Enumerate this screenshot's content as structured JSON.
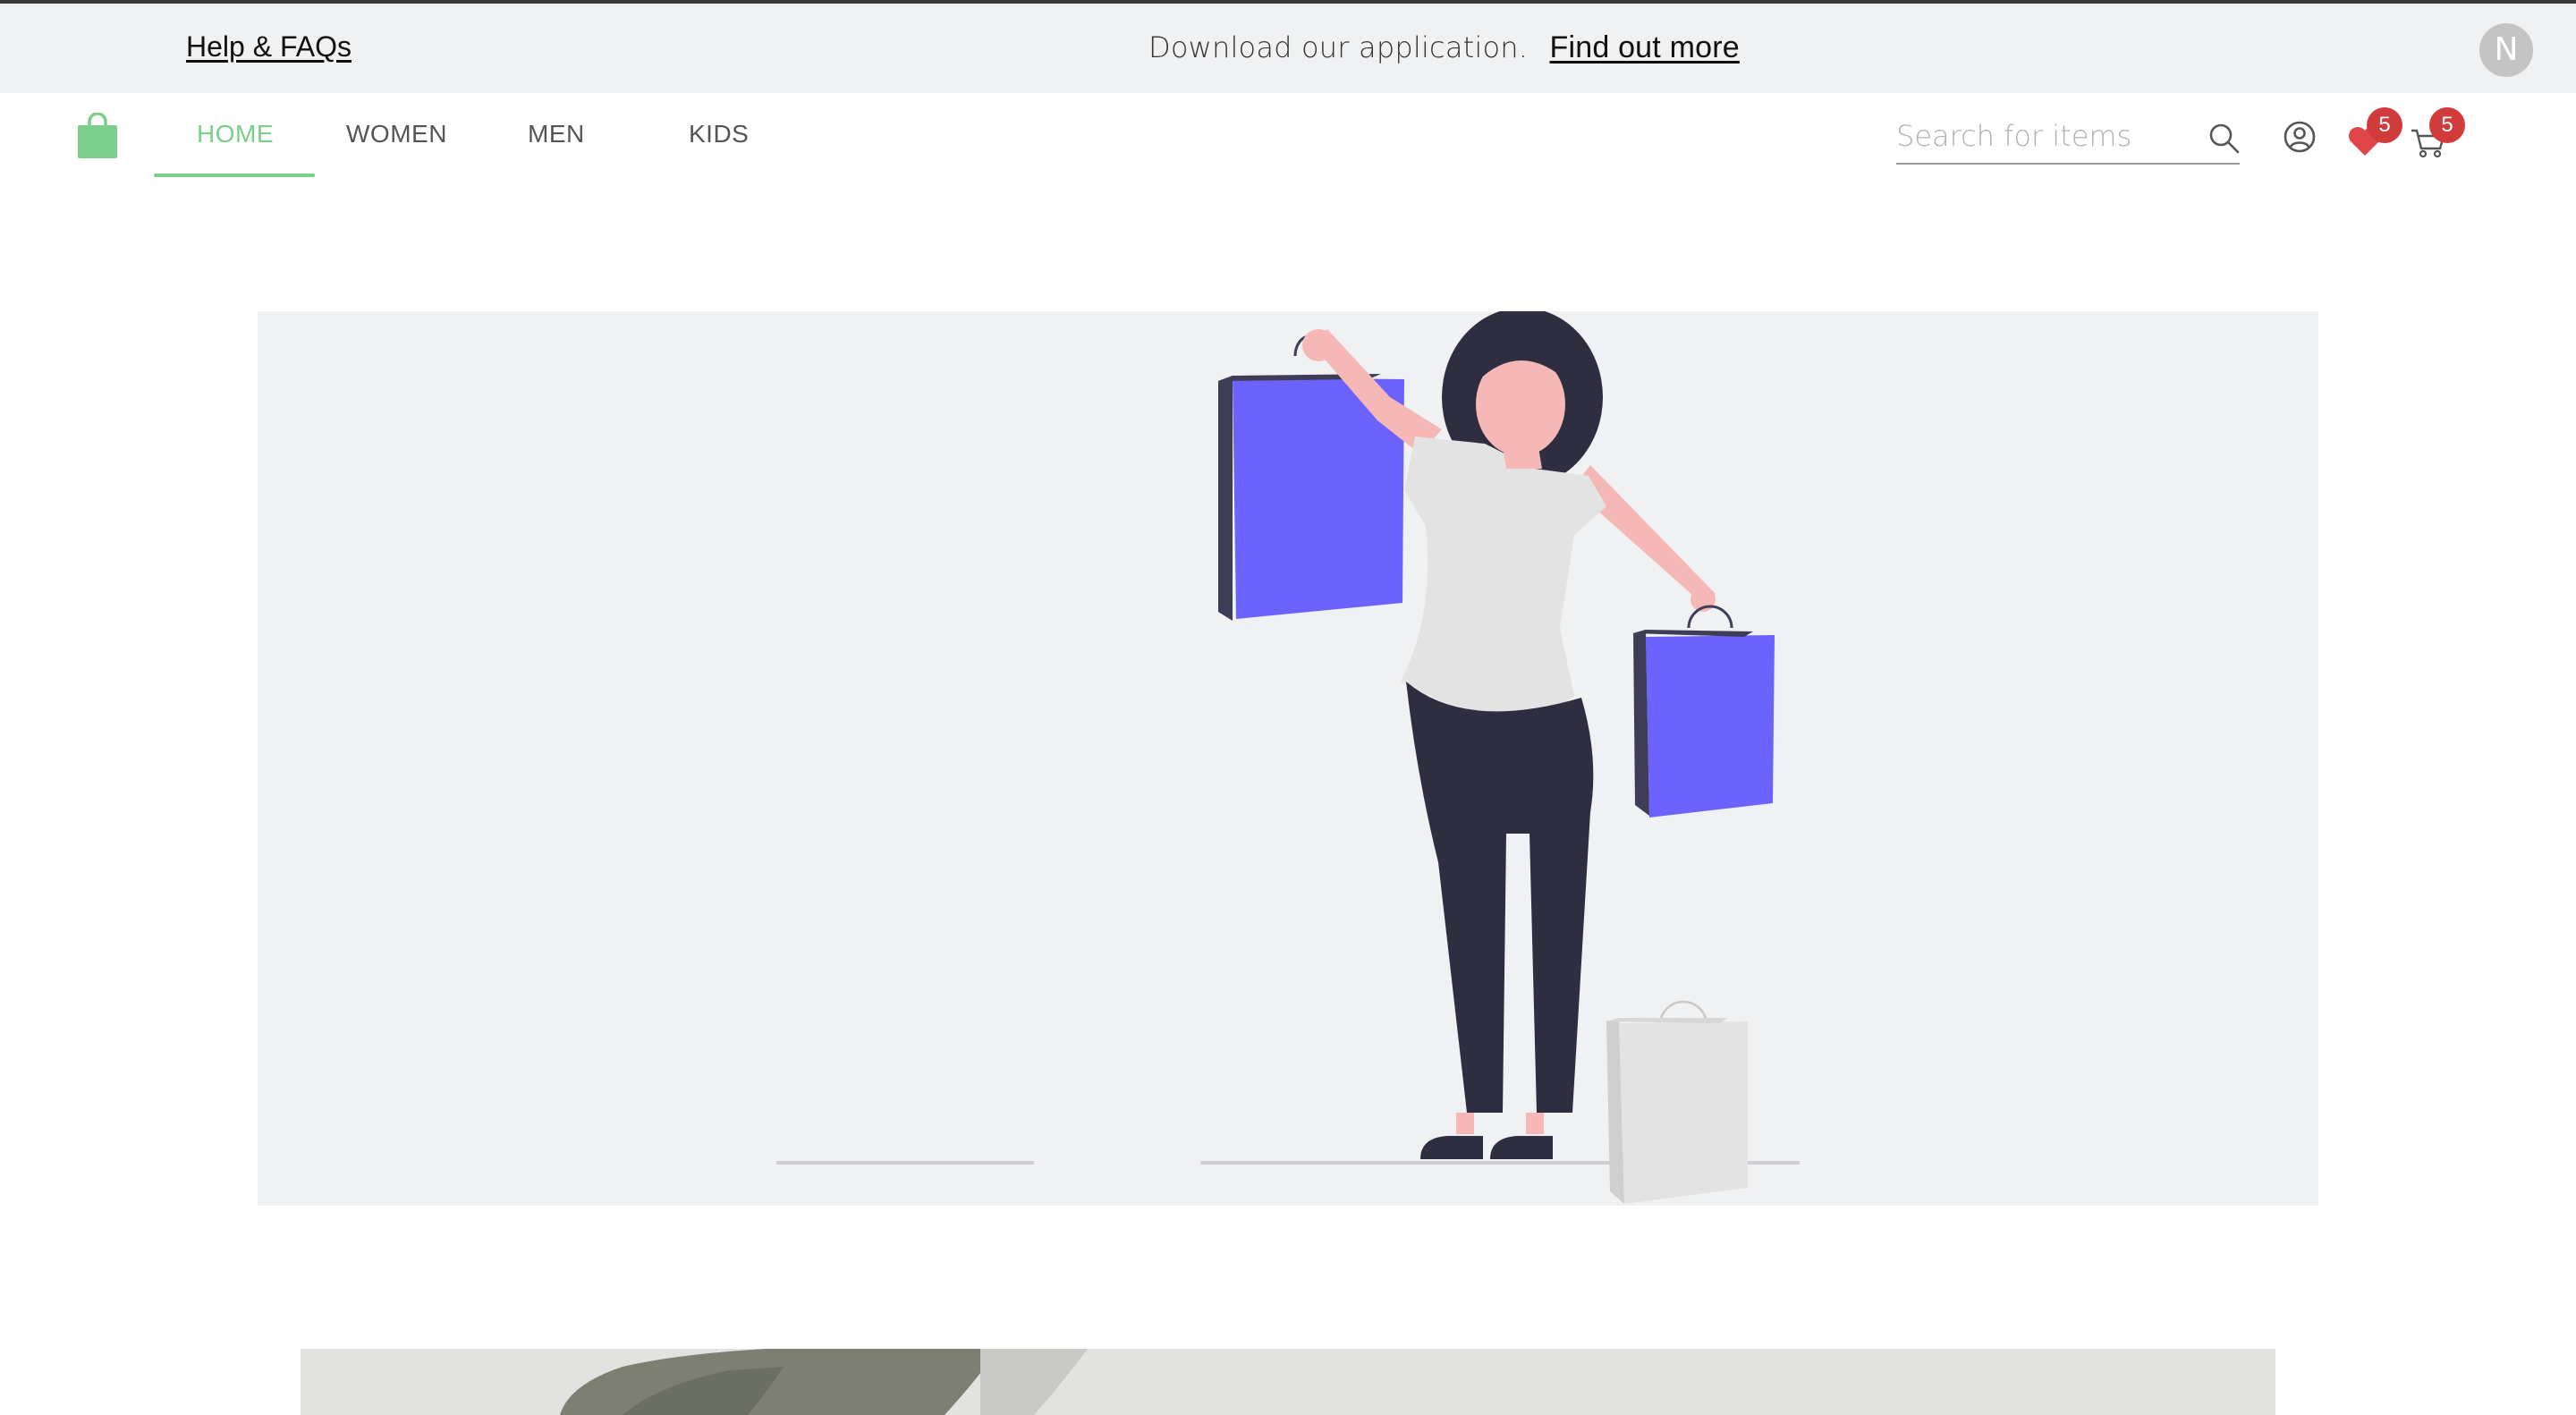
{
  "announcement": {
    "help_label": "Help & FAQs",
    "promo_text": "Download our application.",
    "promo_link": "Find out more",
    "avatar_initial": "N"
  },
  "nav": {
    "items": [
      {
        "label": "HOME",
        "active": true
      },
      {
        "label": "WOMEN",
        "active": false
      },
      {
        "label": "MEN",
        "active": false
      },
      {
        "label": "KIDS",
        "active": false
      }
    ],
    "accent_color": "#7ccf8a"
  },
  "search": {
    "placeholder": "Search for items",
    "value": ""
  },
  "header_icons": {
    "wishlist_count": "5",
    "cart_count": "5"
  },
  "hero": {
    "illustration": "woman-with-shopping-bags",
    "bag_color": "#6c63ff"
  }
}
